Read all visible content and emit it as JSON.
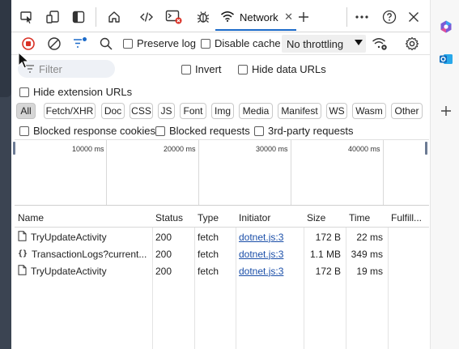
{
  "tabbar": {
    "network_tab_label": "Network"
  },
  "toolbar": {
    "preserve_log_label": "Preserve log",
    "disable_cache_label": "Disable cache",
    "throttling_value": "No throttling"
  },
  "filters": {
    "filter_placeholder": "Filter",
    "invert_label": "Invert",
    "hide_data_urls_label": "Hide data URLs",
    "hide_extension_urls_label": "Hide extension URLs",
    "blocked_response_cookies_label": "Blocked response cookies",
    "blocked_requests_label": "Blocked requests",
    "third_party_label": "3rd-party requests"
  },
  "types": [
    "All",
    "Fetch/XHR",
    "Doc",
    "CSS",
    "JS",
    "Font",
    "Img",
    "Media",
    "Manifest",
    "WS",
    "Wasm",
    "Other"
  ],
  "overview": {
    "ticks": [
      "10000 ms",
      "20000 ms",
      "30000 ms",
      "40000 ms"
    ]
  },
  "table": {
    "columns": [
      "Name",
      "Status",
      "Type",
      "Initiator",
      "Size",
      "Time",
      "Fulfill..."
    ],
    "rows": [
      {
        "name": "TryUpdateActivity",
        "status": "200",
        "type": "fetch",
        "initiator": "dotnet.js:3",
        "size": "172 B",
        "time": "22 ms",
        "icon": "document-icon"
      },
      {
        "name": "TransactionLogs?current...",
        "status": "200",
        "type": "fetch",
        "initiator": "dotnet.js:3",
        "size": "1.1 MB",
        "time": "349 ms",
        "icon": "json-braces-icon"
      },
      {
        "name": "TryUpdateActivity",
        "status": "200",
        "type": "fetch",
        "initiator": "dotnet.js:3",
        "size": "172 B",
        "time": "19 ms",
        "icon": "document-icon"
      }
    ]
  },
  "colors": {
    "record_red": "#d93025",
    "active_tab_underline": "#1b6ac9",
    "link_blue": "#1a4ea8"
  }
}
